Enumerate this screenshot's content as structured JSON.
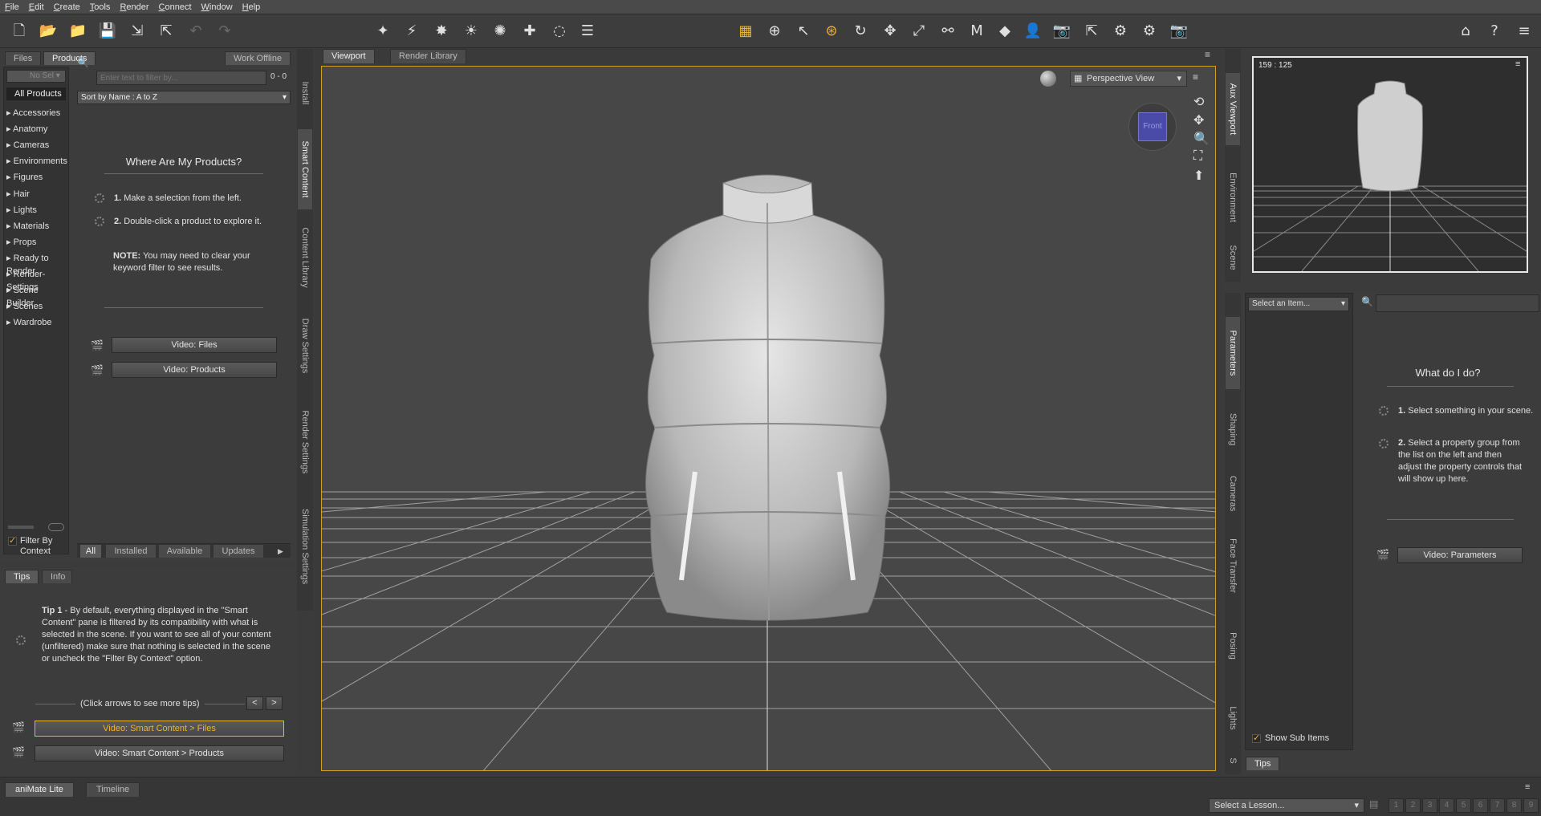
{
  "menu": [
    "File",
    "Edit",
    "Create",
    "Tools",
    "Render",
    "Connect",
    "Window",
    "Help"
  ],
  "left": {
    "tabs": {
      "files": "Files",
      "products": "Products",
      "work_offline": "Work Offline"
    },
    "dropdown_label": "No Sel",
    "all_products": "All Products",
    "categories": [
      "Accessories",
      "Anatomy",
      "Cameras",
      "Environments",
      "Figures",
      "Hair",
      "Lights",
      "Materials",
      "Props",
      "Ready to Render",
      "Render-Settings",
      "Scene Builder",
      "Scenes",
      "Wardrobe"
    ],
    "filter_placeholder": "Enter text to filter by...",
    "count": "0 - 0",
    "sort": "Sort by Name : A to Z",
    "where_title": "Where Are My Products?",
    "step1_num": "1.",
    "step1": "Make a selection from the left.",
    "step2_num": "2.",
    "step2": "Double-click a product to explore it.",
    "note_label": "NOTE:",
    "note": "You may need to clear your keyword filter to see results.",
    "video_files": "Video: Files",
    "video_products": "Video: Products",
    "filter_by_context": "Filter By Context",
    "bottom_tabs": [
      "All",
      "Installed",
      "Available",
      "Updates"
    ],
    "vtabs": [
      "Install",
      "Smart Content",
      "Content Library",
      "Draw Settings",
      "Render Settings",
      "Simulation Settings"
    ]
  },
  "tips": {
    "tabs": {
      "tips": "Tips",
      "info": "Info"
    },
    "tip_label": "Tip 1",
    "tip_text": " - By default, everything displayed in the \"Smart Content\" pane is filtered by its compatibility with what is selected in the scene. If you want to see all of your content (unfiltered) make sure that nothing is selected in the scene or uncheck the \"Filter By Context\" option.",
    "arrows_hint": "(Click arrows to see more tips)",
    "prev": "<",
    "next": ">",
    "video1": "Video: Smart Content > Files",
    "video2": "Video: Smart Content > Products"
  },
  "viewport": {
    "tabs": {
      "viewport": "Viewport",
      "render_library": "Render Library"
    },
    "view": "Perspective View",
    "cube_label": "Front"
  },
  "aux": {
    "coords": "159 : 125",
    "vtabs": [
      "Aux Viewport",
      "Environment",
      "Scene"
    ]
  },
  "params": {
    "select": "Select an Item...",
    "title": "What do I do?",
    "step1_num": "1.",
    "step1": "Select something in your scene.",
    "step2_num": "2.",
    "step2": "Select a property group from the list on the left and then adjust the property controls that will show up here.",
    "video": "Video: Parameters",
    "show_sub": "Show Sub Items",
    "tips_tab": "Tips",
    "vtabs": [
      "Parameters",
      "Shaping",
      "Cameras",
      "Face Transfer",
      "Posing",
      "Lights",
      "S"
    ]
  },
  "bottom": {
    "tabs": {
      "animate": "aniMate Lite",
      "timeline": "Timeline"
    },
    "lesson": "Select a Lesson...",
    "steps": [
      "1",
      "2",
      "3",
      "4",
      "5",
      "6",
      "7",
      "8",
      "9"
    ]
  },
  "colors": {
    "accent": "#f0b428",
    "viewport_bg": "#474747",
    "grid": "#9a9a9a"
  }
}
